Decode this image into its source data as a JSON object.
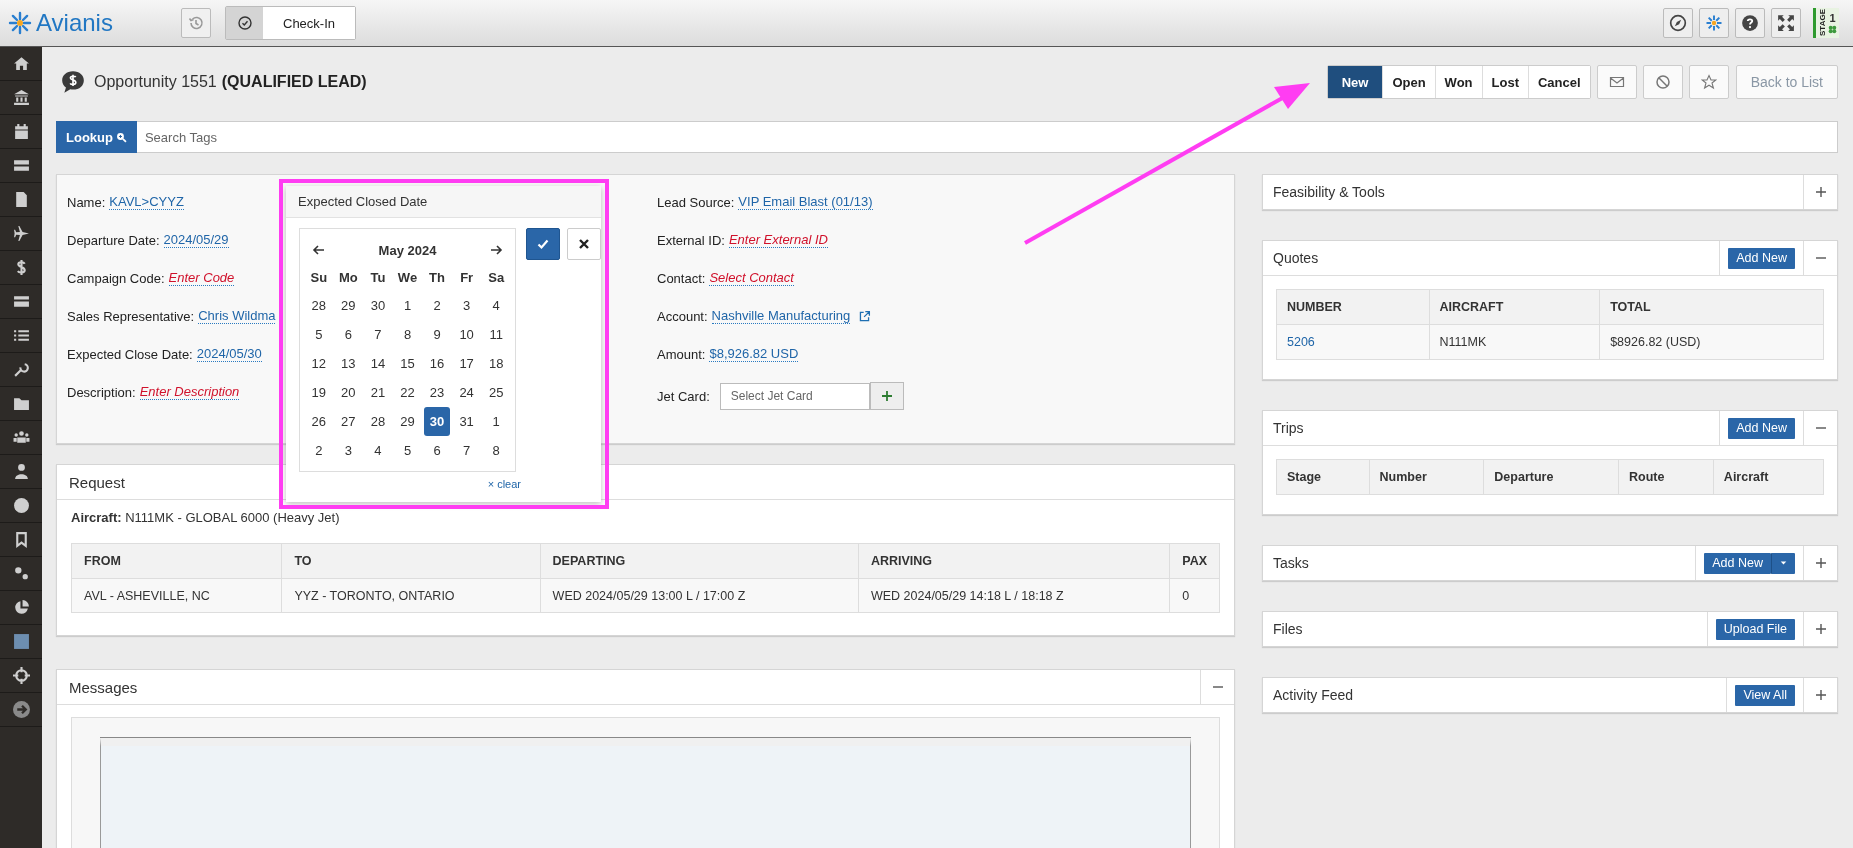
{
  "app": {
    "logo": "Avianis"
  },
  "toolbar": {
    "checkin": "Check-In"
  },
  "stage": {
    "label": "STAGE",
    "number": "1"
  },
  "page": {
    "title": "Opportunity 1551",
    "status": "(QUALIFIED LEAD)"
  },
  "status_buttons": [
    {
      "label": "New",
      "selected": true
    },
    {
      "label": "Open",
      "selected": false
    },
    {
      "label": "Won",
      "selected": false
    },
    {
      "label": "Lost",
      "selected": false
    },
    {
      "label": "Cancel",
      "selected": false
    }
  ],
  "back_button": {
    "label": "Back to List",
    "disabled": true
  },
  "lookup": {
    "button": "Lookup",
    "placeholder": "Search Tags"
  },
  "details": {
    "left": [
      {
        "label": "Name:",
        "value": "KAVL>CYYZ",
        "kind": "value"
      },
      {
        "label": "Departure Date:",
        "value": "2024/05/29",
        "kind": "value"
      },
      {
        "label": "Campaign Code:",
        "value": "Enter Code",
        "kind": "empty"
      },
      {
        "label": "Sales Representative:",
        "value": "Chris Wildma",
        "kind": "value"
      },
      {
        "label": "Expected Close Date:",
        "value": "2024/05/30",
        "kind": "value"
      },
      {
        "label": "Description:",
        "value": "Enter Description",
        "kind": "empty"
      }
    ],
    "right": [
      {
        "label": "Lead Source:",
        "value": "VIP Email Blast (01/13)",
        "kind": "value",
        "external_link": false
      },
      {
        "label": "External ID:",
        "value": "Enter External ID",
        "kind": "empty",
        "external_link": false
      },
      {
        "label": "Contact:",
        "value": "Select Contact",
        "kind": "empty",
        "external_link": false
      },
      {
        "label": "Account:",
        "value": "Nashville Manufacturing",
        "kind": "value",
        "external_link": true
      },
      {
        "label": "Amount:",
        "value": "$8,926.82 USD",
        "kind": "value",
        "external_link": false
      }
    ],
    "jet_card": {
      "label": "Jet Card:",
      "placeholder": "Select Jet Card"
    }
  },
  "date_picker": {
    "title": "Expected Closed Date",
    "month": "May 2024",
    "weekdays": [
      "Su",
      "Mo",
      "Tu",
      "We",
      "Th",
      "Fr",
      "Sa"
    ],
    "days": [
      {
        "day": "28",
        "selected": false
      },
      {
        "day": "29",
        "selected": false
      },
      {
        "day": "30",
        "selected": false
      },
      {
        "day": "1",
        "selected": false
      },
      {
        "day": "2",
        "selected": false
      },
      {
        "day": "3",
        "selected": false
      },
      {
        "day": "4",
        "selected": false
      },
      {
        "day": "5",
        "selected": false
      },
      {
        "day": "6",
        "selected": false
      },
      {
        "day": "7",
        "selected": false
      },
      {
        "day": "8",
        "selected": false
      },
      {
        "day": "9",
        "selected": false
      },
      {
        "day": "10",
        "selected": false
      },
      {
        "day": "11",
        "selected": false
      },
      {
        "day": "12",
        "selected": false
      },
      {
        "day": "13",
        "selected": false
      },
      {
        "day": "14",
        "selected": false
      },
      {
        "day": "15",
        "selected": false
      },
      {
        "day": "16",
        "selected": false
      },
      {
        "day": "17",
        "selected": false
      },
      {
        "day": "18",
        "selected": false
      },
      {
        "day": "19",
        "selected": false
      },
      {
        "day": "20",
        "selected": false
      },
      {
        "day": "21",
        "selected": false
      },
      {
        "day": "22",
        "selected": false
      },
      {
        "day": "23",
        "selected": false
      },
      {
        "day": "24",
        "selected": false
      },
      {
        "day": "25",
        "selected": false
      },
      {
        "day": "26",
        "selected": false
      },
      {
        "day": "27",
        "selected": false
      },
      {
        "day": "28",
        "selected": false
      },
      {
        "day": "29",
        "selected": false
      },
      {
        "day": "30",
        "selected": true
      },
      {
        "day": "31",
        "selected": false
      },
      {
        "day": "1",
        "selected": false
      },
      {
        "day": "2",
        "selected": false
      },
      {
        "day": "3",
        "selected": false
      },
      {
        "day": "4",
        "selected": false
      },
      {
        "day": "5",
        "selected": false
      },
      {
        "day": "6",
        "selected": false
      },
      {
        "day": "7",
        "selected": false
      },
      {
        "day": "8",
        "selected": false
      }
    ],
    "clear": "× clear"
  },
  "request": {
    "title": "Request",
    "aircraft": "**Aircraft:** N111MK - GLOBAL 6000 (Heavy Jet)",
    "columns": [
      "FROM",
      "TO",
      "DEPARTING",
      "ARRIVING",
      "PAX"
    ],
    "rows": [
      [
        "AVL - ASHEVILLE, NC",
        "YYZ - TORONTO, ONTARIO",
        "WED 2024/05/29 13:00 L / 17:00 Z",
        "WED 2024/05/29 14:18 L / 18:18 Z",
        "0"
      ]
    ]
  },
  "messages": {
    "title": "Messages",
    "expanded": true
  },
  "panels": [
    {
      "title": "Feasibility & Tools",
      "expanded": false
    },
    {
      "title": "Quotes",
      "expanded": true,
      "action": {
        "label": "Add New",
        "kind": "button"
      },
      "table": {
        "columns": [
          "NUMBER",
          "AIRCRAFT",
          "TOTAL"
        ],
        "rows": [
          [
            "5206",
            "N111MK",
            "$8926.82 (USD)"
          ]
        ]
      }
    },
    {
      "title": "Trips",
      "expanded": true,
      "action": {
        "label": "Add New",
        "kind": "button"
      },
      "table": {
        "columns": [
          "Stage",
          "Number",
          "Departure",
          "Route",
          "Aircraft"
        ]
      }
    },
    {
      "title": "Tasks",
      "expanded": false,
      "action": {
        "label": "Add New",
        "kind": "split"
      }
    },
    {
      "title": "Files",
      "expanded": false,
      "action": {
        "label": "Upload File",
        "kind": "button"
      }
    },
    {
      "title": "Activity Feed",
      "expanded": false,
      "action": {
        "label": "View All",
        "kind": "button"
      }
    }
  ]
}
